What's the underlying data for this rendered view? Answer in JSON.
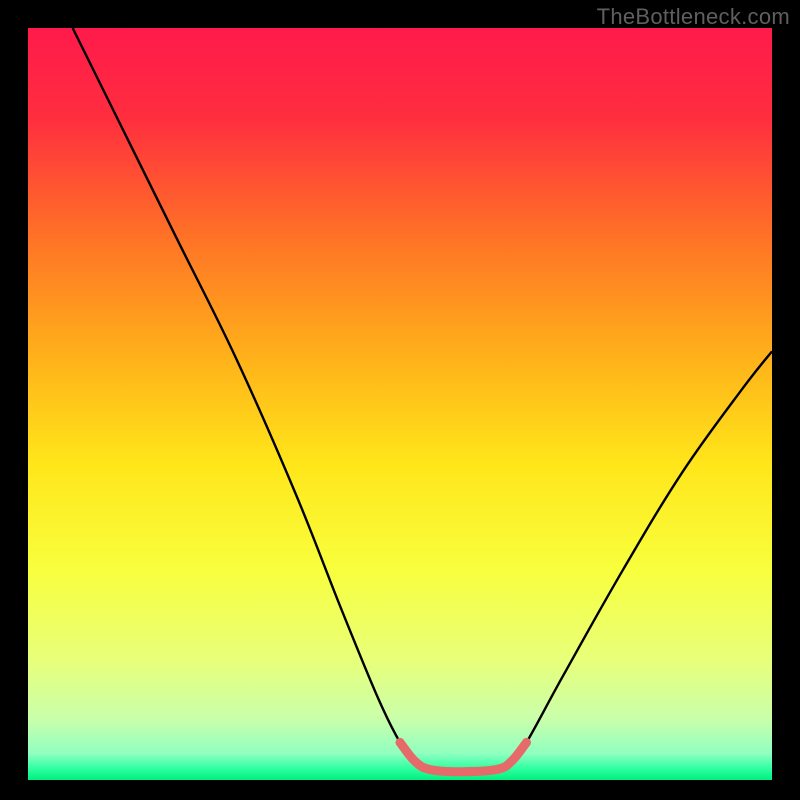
{
  "credit": "TheBottleneck.com",
  "chart_data": {
    "type": "line",
    "title": "",
    "xlabel": "",
    "ylabel": "",
    "x_range": [
      0,
      100
    ],
    "y_range": [
      0,
      100
    ],
    "gradient_stops": [
      {
        "pos": 0.0,
        "color": "#ff1a4b"
      },
      {
        "pos": 0.12,
        "color": "#ff2e3f"
      },
      {
        "pos": 0.28,
        "color": "#ff7326"
      },
      {
        "pos": 0.44,
        "color": "#ffb21a"
      },
      {
        "pos": 0.58,
        "color": "#ffe61a"
      },
      {
        "pos": 0.72,
        "color": "#f8ff3d"
      },
      {
        "pos": 0.84,
        "color": "#e8ff7a"
      },
      {
        "pos": 0.92,
        "color": "#c9ffab"
      },
      {
        "pos": 0.965,
        "color": "#8fffc0"
      },
      {
        "pos": 0.985,
        "color": "#2dffa0"
      },
      {
        "pos": 1.0,
        "color": "#00f07e"
      }
    ],
    "series": [
      {
        "name": "bottleneck-curve",
        "color": "#000000",
        "width": 2.4,
        "points": [
          {
            "x": 6,
            "y": 100
          },
          {
            "x": 12,
            "y": 88
          },
          {
            "x": 20,
            "y": 72
          },
          {
            "x": 28,
            "y": 56
          },
          {
            "x": 36,
            "y": 38
          },
          {
            "x": 42,
            "y": 23
          },
          {
            "x": 47,
            "y": 11
          },
          {
            "x": 50,
            "y": 5
          },
          {
            "x": 52,
            "y": 2.5
          },
          {
            "x": 54,
            "y": 1.4
          },
          {
            "x": 58,
            "y": 1.1
          },
          {
            "x": 63,
            "y": 1.4
          },
          {
            "x": 65,
            "y": 2.5
          },
          {
            "x": 67,
            "y": 5
          },
          {
            "x": 72,
            "y": 14
          },
          {
            "x": 80,
            "y": 28
          },
          {
            "x": 88,
            "y": 41
          },
          {
            "x": 96,
            "y": 52
          },
          {
            "x": 100,
            "y": 57
          }
        ]
      },
      {
        "name": "valley-overlay",
        "color": "#e66a6a",
        "width": 9,
        "linecap": "round",
        "points": [
          {
            "x": 50,
            "y": 5
          },
          {
            "x": 52,
            "y": 2.5
          },
          {
            "x": 54,
            "y": 1.4
          },
          {
            "x": 58,
            "y": 1.1
          },
          {
            "x": 63,
            "y": 1.4
          },
          {
            "x": 65,
            "y": 2.5
          },
          {
            "x": 67,
            "y": 5
          }
        ]
      }
    ]
  }
}
